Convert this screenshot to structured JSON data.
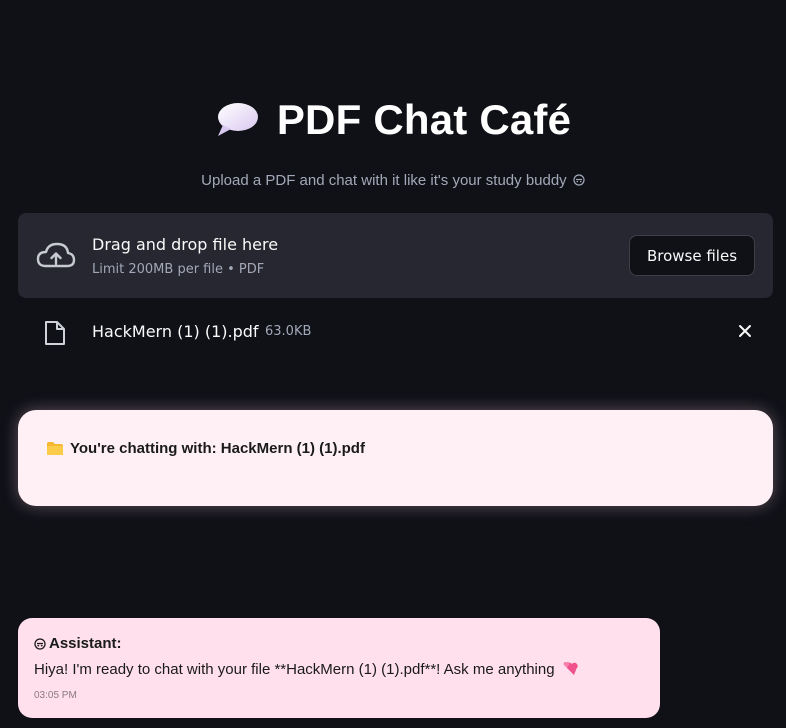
{
  "header": {
    "title": "PDF Chat Café",
    "title_icon": "speech-bubble-icon",
    "subtitle": "Upload a PDF and chat with it like it's your study buddy"
  },
  "uploader": {
    "drop_title": "Drag and drop file here",
    "drop_limit": "Limit 200MB per file • PDF",
    "browse_label": "Browse files",
    "icon": "cloud-upload-icon"
  },
  "uploaded_file": {
    "name": "HackMern (1) (1).pdf",
    "size": "63.0KB",
    "icon": "file-icon",
    "remove_icon": "close-icon"
  },
  "chatting_with": {
    "icon": "folder-icon",
    "text": "You're chatting with: HackMern (1) (1).pdf"
  },
  "messages": [
    {
      "role_label": "Assistant:",
      "icon": "robot-icon",
      "text": "Hiya! I'm ready to chat with your file **HackMern (1) (1).pdf**! Ask me anything",
      "trailing_icon": "two-hearts-icon",
      "time": "03:05 PM"
    }
  ],
  "colors": {
    "background": "#0f1117",
    "uploader_bg": "#262730",
    "chatting_card_bg": "#fff0f5",
    "assistant_bubble_bg": "#ffe0ec",
    "heart": "#f0508c"
  }
}
